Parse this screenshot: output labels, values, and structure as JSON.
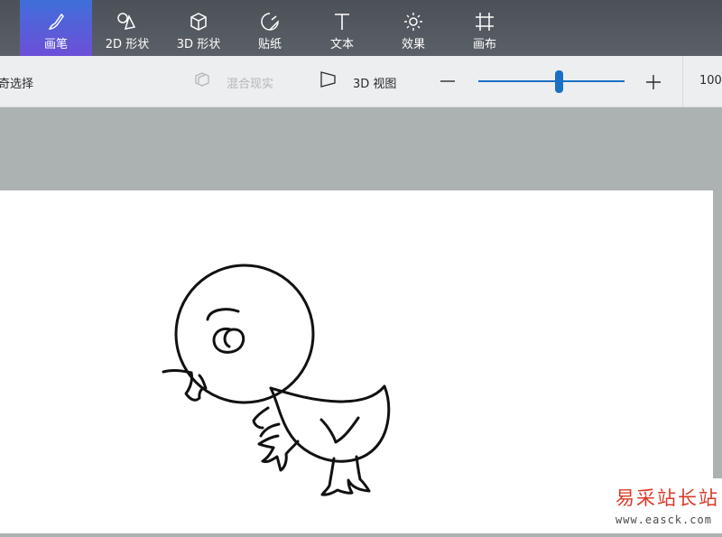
{
  "top_tabs": [
    {
      "label": "画笔",
      "icon": "brush-icon",
      "active": true
    },
    {
      "label": "2D 形状",
      "icon": "2d-shapes-icon"
    },
    {
      "label": "3D 形状",
      "icon": "3d-shapes-icon"
    },
    {
      "label": "贴纸",
      "icon": "stickers-icon"
    },
    {
      "label": "文本",
      "icon": "text-icon"
    },
    {
      "label": "效果",
      "icon": "effects-icon"
    },
    {
      "label": "画布",
      "icon": "canvas-icon"
    }
  ],
  "toolbar": {
    "magic_select": "奇选择",
    "mixed_reality": "混合现实",
    "view_3d": "3D 视图",
    "zoom_value": "100",
    "zoom_level": 0.55
  },
  "watermark": {
    "title": "易采站长站",
    "url": "www.easck.com"
  },
  "colors": {
    "accent": "#1a70c4",
    "active_tab_start": "#3f6fd9",
    "active_tab_end": "#6d4fd8",
    "watermark_red": "#d93a2a"
  }
}
